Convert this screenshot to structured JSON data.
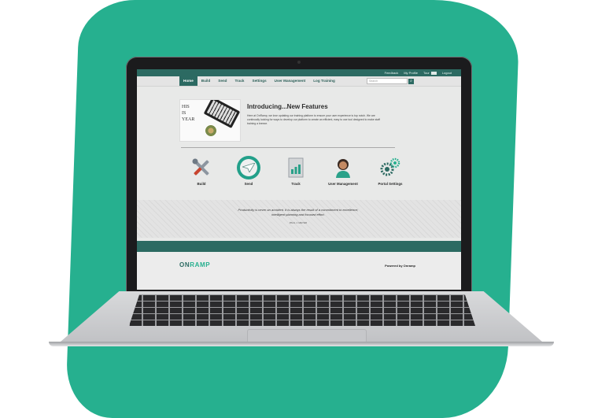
{
  "topbar": {
    "links": [
      "Feedback",
      "My Profile",
      "Tour",
      "Logout"
    ]
  },
  "nav": {
    "items": [
      "Home",
      "Build",
      "Send",
      "Track",
      "Settings",
      "User Management",
      "Log Training"
    ],
    "active": "Home",
    "search_placeholder": "Search"
  },
  "feature": {
    "image_text": [
      "HIS",
      "IS",
      "YEAR"
    ],
    "title": "Introducing...New Features",
    "body": "Here at OnRamp, we love updating our training platform to ensure your user experience is top notch. We are continually looking for ways to develop our platform to create an efficient, easy to use tool designed to make staff training a breeze."
  },
  "tiles": [
    {
      "label": "Build",
      "icon": "tools-icon"
    },
    {
      "label": "Send",
      "icon": "send-plane-icon"
    },
    {
      "label": "Track",
      "icon": "report-chart-icon"
    },
    {
      "label": "User Management",
      "icon": "user-avatar-icon"
    },
    {
      "label": "Portal Settings",
      "icon": "gears-icon"
    }
  ],
  "quote": {
    "text": "Productivity is never an accident. It is always the result of a commitment to excellence, intelligent planning and focused effort.",
    "author": "PAUL J. MEYER"
  },
  "footer": {
    "logo_on": "ON",
    "logo_ramp": "RAMP",
    "powered_by": "Powered by Onramp"
  },
  "colors": {
    "brand_teal": "#2c6a62",
    "accent_green": "#26b08f",
    "page_bg": "#e8e9e8"
  }
}
